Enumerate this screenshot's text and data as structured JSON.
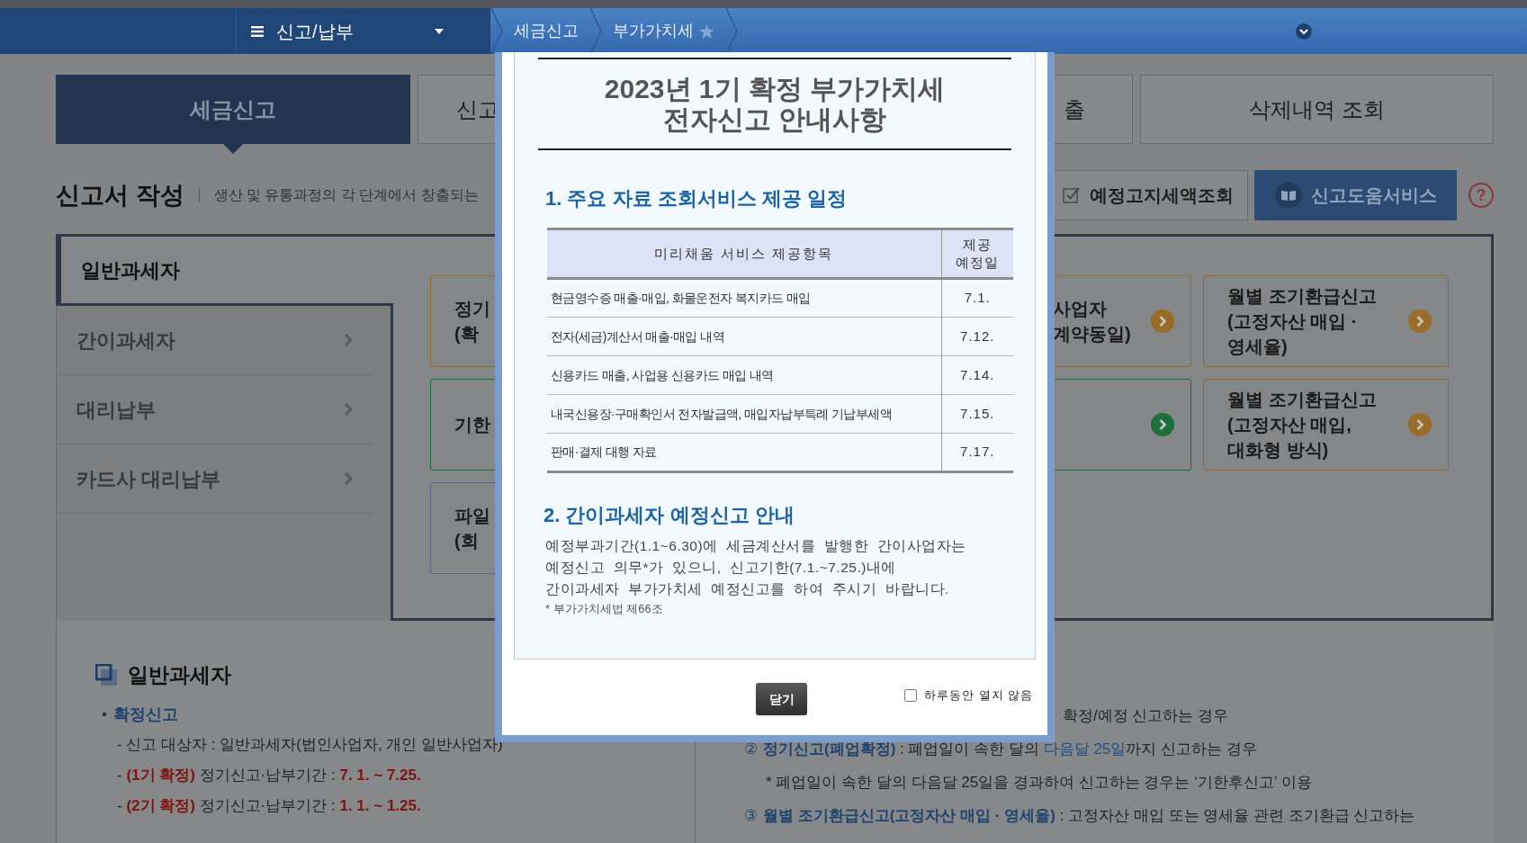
{
  "nav": {
    "menu_title": "신고/납부",
    "breadcrumbs": [
      "세금신고",
      "부가가치세"
    ],
    "favorite": false
  },
  "tabs": [
    {
      "label": "세금신고",
      "selected": true
    },
    {
      "label": "신고",
      "selected": false
    },
    {
      "label": "출",
      "selected": false
    },
    {
      "label": "삭제내역 조회",
      "selected": false
    }
  ],
  "section": {
    "title": "신고서 작성",
    "description": "생산 및 유통과정의 각 단계에서 창출되는"
  },
  "action_buttons": [
    {
      "label": "예정고지세액조회",
      "kind": "check",
      "primary": false
    },
    {
      "label": "신고도움서비스",
      "kind": "book",
      "primary": true
    }
  ],
  "help": "?",
  "sidebar": [
    {
      "label": "일반과세자",
      "selected": true
    },
    {
      "label": "간이과세자",
      "selected": false
    },
    {
      "label": "대리납부",
      "selected": false
    },
    {
      "label": "카드사 대리납부",
      "selected": false
    }
  ],
  "cards": {
    "column_1": [
      {
        "lines": [
          "정기",
          "(확"
        ],
        "color": "#9b6b29"
      },
      {
        "lines": [
          "기한"
        ],
        "color": "#1c6e3c"
      },
      {
        "lines": [
          "파일",
          "(회"
        ],
        "color": "#5f6689"
      }
    ],
    "column_3": [
      {
        "lines": [
          "사업자",
          "계약동일)"
        ],
        "color": "#9b6b29",
        "arrow": true
      },
      {
        "color": "#1c6e3c",
        "arrow": true
      }
    ],
    "column_4": [
      {
        "lines": [
          "월별 조기환급신고",
          "(고정자산 매입 ·",
          "영세율)"
        ],
        "color": "#9b6b29",
        "arrow": true
      },
      {
        "lines": [
          "월별 조기환급신고",
          "(고정자산 매입,",
          "대화형 방식)"
        ],
        "color": "#9b6b29",
        "arrow": true
      }
    ]
  },
  "general": {
    "title": "일반과세자",
    "subtitle": "확정신고",
    "lines": [
      [
        {
          "text": "- 신고 대상자 : 일반과세자(법인사업자, 개인 일반사업자)",
          "kind": "plain"
        }
      ],
      [
        {
          "text": "- ",
          "kind": "plain"
        },
        {
          "text": "(1기 확정)",
          "kind": "red"
        },
        {
          "text": " 정기신고·납부기간 : ",
          "kind": "plain"
        },
        {
          "text": "7. 1. ~ 7.25.",
          "kind": "red"
        }
      ],
      [
        {
          "text": "- ",
          "kind": "plain"
        },
        {
          "text": "(2기 확정)",
          "kind": "red"
        },
        {
          "text": " 정기신고·납부기간 : ",
          "kind": "plain"
        },
        {
          "text": "1. 1. ~ 1.25.",
          "kind": "red"
        }
      ]
    ]
  },
  "notes": [
    {
      "kind": "cut",
      "segments": [
        {
          "text": "확정/예정 신고하는 경우",
          "kind": "plain"
        }
      ]
    },
    {
      "kind": "item",
      "segments": [
        {
          "text": "②",
          "kind": "number"
        },
        {
          "text": "정기신고(폐업확정)",
          "kind": "strong"
        },
        {
          "text": " : 폐업일이 속한 달의 ",
          "kind": "plain"
        },
        {
          "text": "다음달 25일",
          "kind": "accent"
        },
        {
          "text": "까지 신고하는 경우",
          "kind": "plain"
        }
      ]
    },
    {
      "kind": "note",
      "segments": [
        {
          "text": "* 폐업일이 속한 달의 다음달 25일을 경과하여 신고하는 경우는 ‘기한후신고’ 이용",
          "kind": "plain"
        }
      ]
    },
    {
      "kind": "item",
      "segments": [
        {
          "text": "③",
          "kind": "number"
        },
        {
          "text": "월별 조기환급신고(고정자산 매입 · 영세율)",
          "kind": "strong"
        },
        {
          "text": " : 고정자산 매입 또는 영세율 관련 조기환급 신고하는",
          "kind": "plain"
        }
      ]
    }
  ],
  "notice": {
    "title_lines": [
      "2023년 1기 확정 부가가치세",
      "전자신고 안내사항"
    ],
    "section_1": {
      "heading": "1. 주요 자료 조회서비스 제공 일정",
      "columns": [
        "미리채움 서비스 제공항목",
        "제공 예정일"
      ],
      "rows": [
        {
          "item": "현금영수증 매출·매입, 화물운전자 복지카드 매입",
          "date": "7.1."
        },
        {
          "item": "전자(세금)계산서 매출·매입 내역",
          "date": "7.12."
        },
        {
          "item": "신용카드 매출, 사업용 신용카드 매입 내역",
          "date": "7.14."
        },
        {
          "item": "내국신용장·구매확인서 전자발급액, 매입자납부특례 기납부세액",
          "date": "7.15."
        },
        {
          "item": "판매·결제 대행 자료",
          "date": "7.17."
        }
      ]
    },
    "section_2": {
      "heading": "2. 간이과세자 예정신고 안내",
      "lines": [
        "예정부과기간(1.1~6.30)에  세금계산서를  발행한  간이사업자는",
        "예정신고  의무*가  있으니,  신고기한(7.1.~7.25.)내에",
        "간이과세자  부가가치세  예정신고를  하여  주시기  바랍니다."
      ],
      "footnote": "* 부가가치세법 제66조"
    },
    "close_button": "닫기",
    "dismiss": {
      "label": "하루동안 열지 않음",
      "checked": false
    }
  }
}
